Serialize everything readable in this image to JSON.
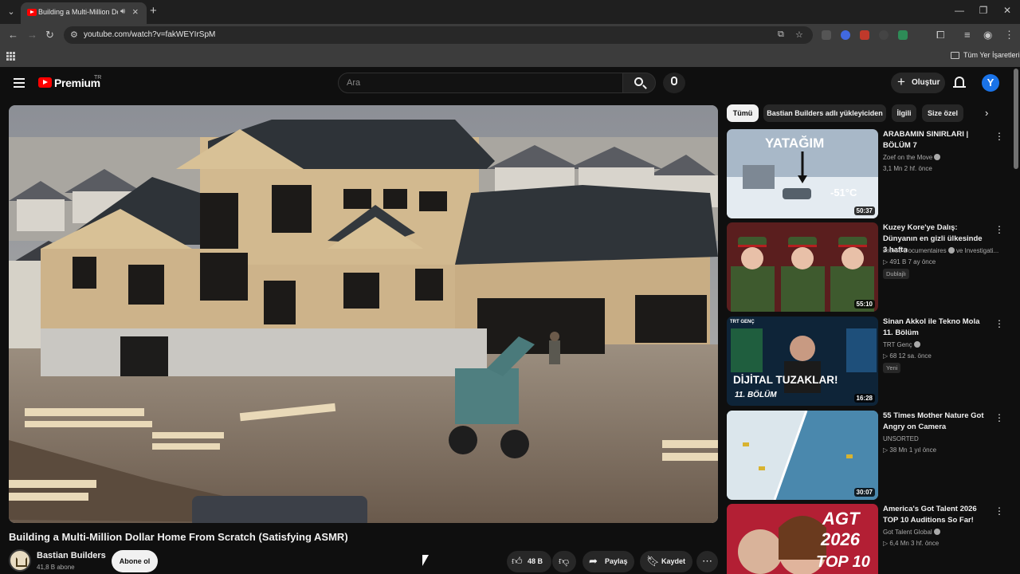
{
  "browser": {
    "tab_title": "Building a Multi-Million Dollar Home From Scratch (Satisfying ASMR)",
    "url": "youtube.com/watch?v=fakWEYIrSpM",
    "bookmark_folder": "Tüm Yer İşaretleri"
  },
  "header": {
    "brand": "Premium",
    "region": "TR",
    "search_placeholder": "Ara",
    "create_label": "Oluştur",
    "avatar_letter": "Y"
  },
  "video": {
    "title": "Building a Multi-Million Dollar Home From Scratch (Satisfying ASMR)",
    "channel": "Bastian Builders",
    "subscribers": "41,8 B abone",
    "subscribe_label": "Abone ol",
    "likes": "48 B",
    "share_label": "Paylaş",
    "save_label": "Kaydet"
  },
  "chips": [
    {
      "label": "Tümü",
      "active": true
    },
    {
      "label": "Bastian Builders adlı yükleyiciden",
      "active": false
    },
    {
      "label": "İlgili",
      "active": false
    },
    {
      "label": "Size özel",
      "active": false
    }
  ],
  "recommendations": [
    {
      "title": "ARABAMIN SINIRLARI | BÖLÜM 7",
      "channel": "Zoef on the Move",
      "meta": "3,1 Mn  2 hf. önce",
      "duration": "50:37",
      "thumb_text": "YATAĞIM",
      "thumb_sub": "-51°C",
      "badge": ""
    },
    {
      "title": "Kuzey Kore'ye Dalış: Dünyanın en gizli ülkesinde 3 hafta",
      "channel": "imineo Documentaires",
      "channel_extra": "ve Investigati...",
      "meta": "491 B  7 ay önce",
      "duration": "55:10",
      "badge": "Dublajlı"
    },
    {
      "title": "Sinan Akkol ile Tekno Mola 11. Bölüm",
      "channel": "TRT Genç",
      "meta": "68  12 sa. önce",
      "duration": "16:28",
      "thumb_text": "DİJİTAL TUZAKLAR!",
      "thumb_sub": "11. BÖLÜM",
      "thumb_tag": "TRT GENÇ",
      "badge": "Yeni"
    },
    {
      "title": "55 Times Mother Nature Got Angry on Camera",
      "channel": "UNSORTED",
      "meta": "38 Mn  1 yıl önce",
      "duration": "30:07",
      "badge": ""
    },
    {
      "title": "America's Got Talent 2026 TOP 10 Auditions So Far!",
      "channel": "Got Talent Global",
      "meta": "6,4 Mn  3 hf. önce",
      "duration": "",
      "thumb_text": "AGT",
      "thumb_sub": "2026",
      "thumb_tag": "TOP 10",
      "badge": ""
    }
  ],
  "colors": {
    "bg": "#0f0f0f",
    "brand_red": "#ff0000",
    "chip_bg": "#272727",
    "text": "#f1f1f1",
    "muted": "#aaaaaa"
  }
}
